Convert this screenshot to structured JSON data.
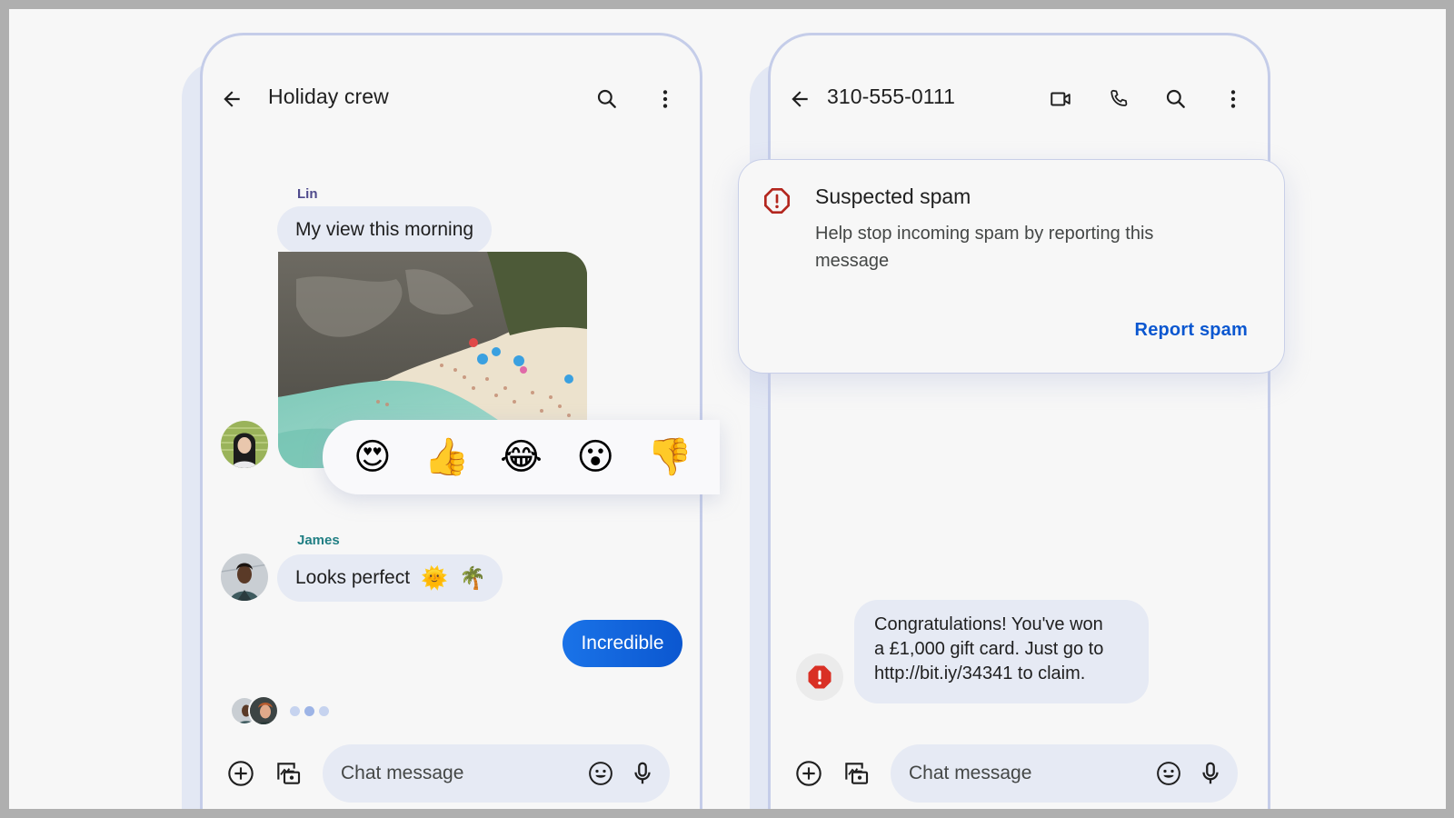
{
  "left_phone": {
    "header": {
      "title": "Holiday crew",
      "back_icon": "arrow-back-icon",
      "search_icon": "search-icon",
      "more_icon": "more-vert-icon"
    },
    "messages": [
      {
        "sender": "Lin",
        "sender_color": "#4f4a8c",
        "text": "My view this morning",
        "type": "incoming"
      },
      {
        "sender": "Lin",
        "type": "image",
        "alt": "Beach cove with turquoise water and sunbathers"
      },
      {
        "sender": "James",
        "sender_color": "#217f84",
        "text": "Looks perfect",
        "emojis": [
          "🌞",
          "🌴"
        ],
        "type": "incoming"
      },
      {
        "text": "Incredible",
        "type": "outgoing"
      }
    ],
    "reactions": [
      "😍",
      "👍",
      "😂",
      "😮",
      "👎"
    ],
    "typing_indicator": {
      "participants": 2
    },
    "composer": {
      "placeholder": "Chat message",
      "add_icon": "add-circle-icon",
      "gallery_icon": "gallery-camera-icon",
      "emoji_icon": "emoji-icon",
      "mic_icon": "mic-icon"
    }
  },
  "right_phone": {
    "header": {
      "title": "310-555-0111",
      "back_icon": "arrow-back-icon",
      "video_icon": "videocam-icon",
      "call_icon": "phone-icon",
      "search_icon": "search-icon",
      "more_icon": "more-vert-icon"
    },
    "spam_card": {
      "title": "Suspected spam",
      "body": "Help stop incoming spam by reporting this message",
      "action": "Report spam",
      "icon": "warning-octagon-icon",
      "icon_color": "#b3261e"
    },
    "message": {
      "text": "Congratulations! You've won\na £1,000 gift card. Just go to\nhttp://bit.iy/34341 to claim.",
      "warning_icon": "spam-warning-icon",
      "warning_color": "#d93025"
    },
    "composer": {
      "placeholder": "Chat message",
      "add_icon": "add-circle-icon",
      "gallery_icon": "gallery-camera-icon",
      "emoji_icon": "emoji-icon",
      "mic_icon": "mic-icon"
    }
  },
  "colors": {
    "accent": "#0b57d0",
    "bubble_incoming": "#e6eaf4",
    "frame_border": "#c5cde9"
  }
}
